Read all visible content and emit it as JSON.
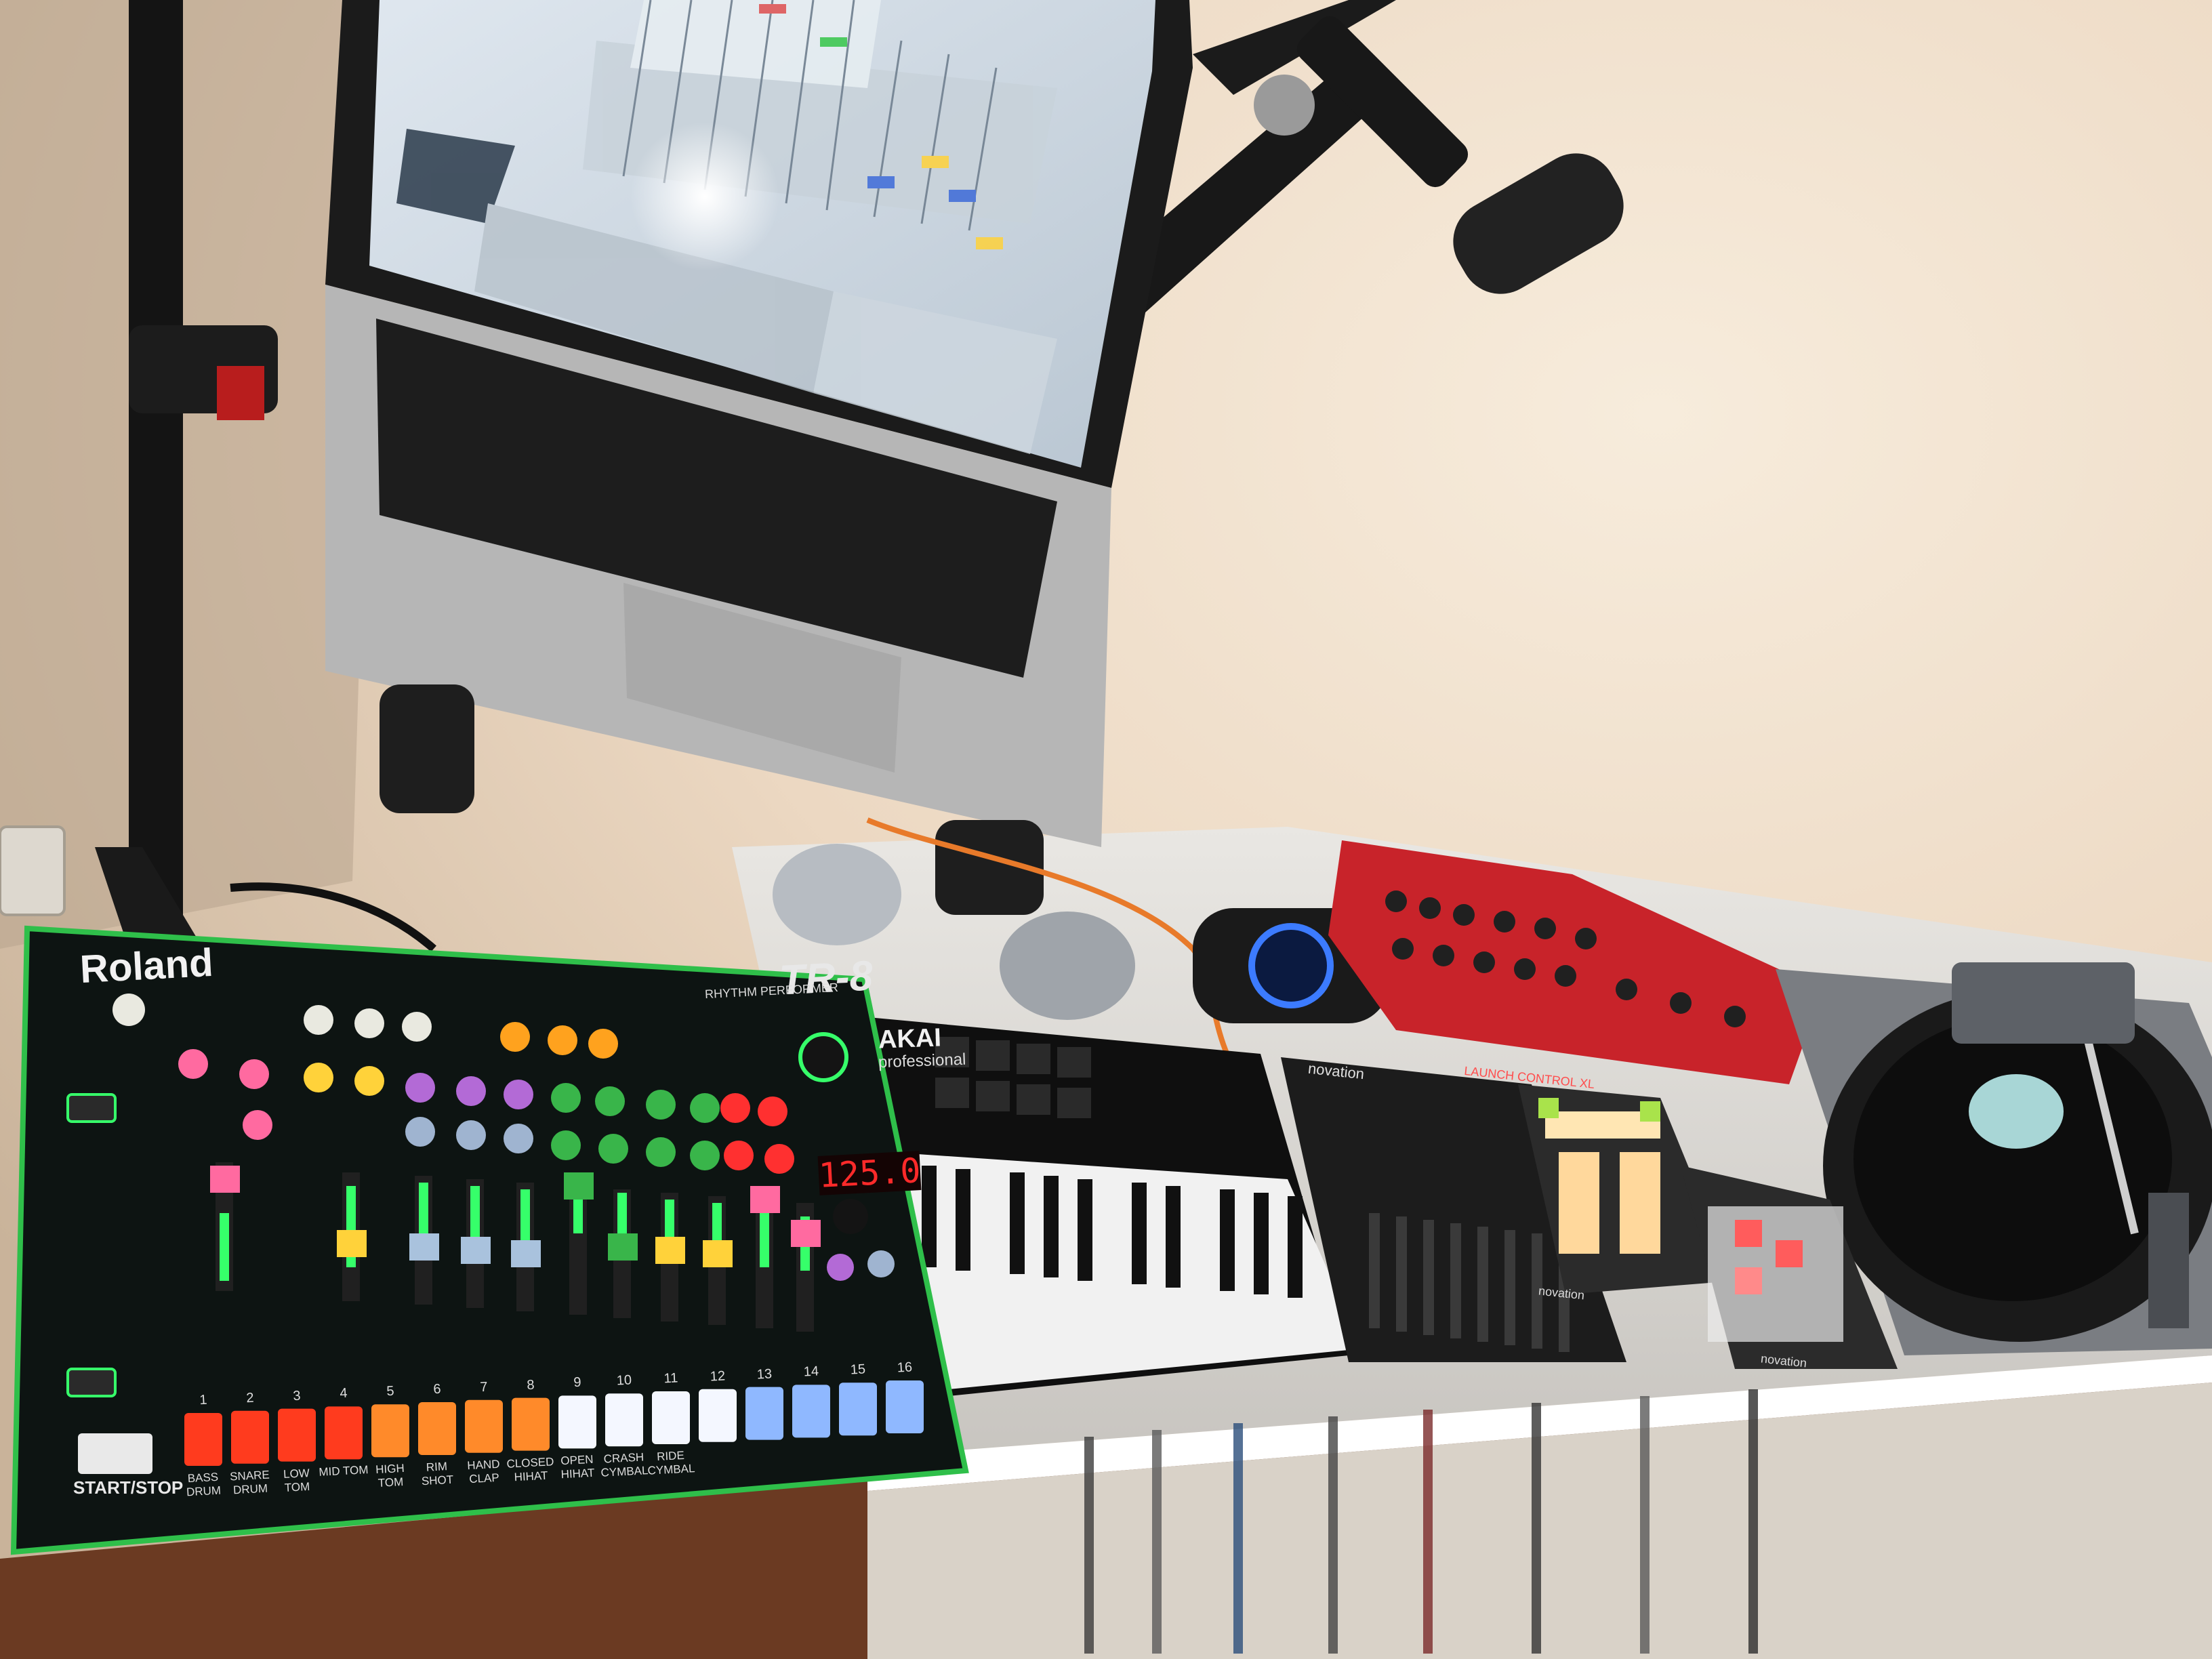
{
  "roland": {
    "brand": "Roland",
    "model": "TR-8",
    "subtitle": "RHYTHM PERFORMER",
    "tempo": "125.0",
    "start_stop": "START/STOP"
  },
  "pads": [
    {
      "num": "1",
      "label": "BASS DRUM"
    },
    {
      "num": "2",
      "label": "SNARE DRUM"
    },
    {
      "num": "3",
      "label": "LOW TOM"
    },
    {
      "num": "4",
      "label": "MID TOM"
    },
    {
      "num": "5",
      "label": "HIGH TOM"
    },
    {
      "num": "6",
      "label": "RIM SHOT"
    },
    {
      "num": "7",
      "label": "HAND CLAP"
    },
    {
      "num": "8",
      "label": "CLOSED HIHAT"
    },
    {
      "num": "9",
      "label": "OPEN HIHAT"
    },
    {
      "num": "10",
      "label": "CRASH CYMBAL"
    },
    {
      "num": "11",
      "label": "RIDE CYMBAL"
    },
    {
      "num": "12",
      "label": ""
    },
    {
      "num": "13",
      "label": ""
    },
    {
      "num": "14",
      "label": ""
    },
    {
      "num": "15",
      "label": ""
    },
    {
      "num": "16",
      "label": ""
    }
  ],
  "akai": {
    "brand": "AKAI",
    "model": "professional"
  },
  "novation": {
    "brand": "novation",
    "launch_control": "LAUNCH CONTROL XL",
    "launchpad": "novation",
    "launchpad_mini": "novation"
  },
  "colors": {
    "pad_red": "#ff3b1e",
    "pad_orange": "#ff8a2a",
    "pad_yellow": "#ffd86a",
    "pad_white": "#f4f7ff",
    "pad_blue": "#8fb8ff",
    "tempo_red": "#ff2a2a",
    "mixer_red": "#c8232a"
  }
}
